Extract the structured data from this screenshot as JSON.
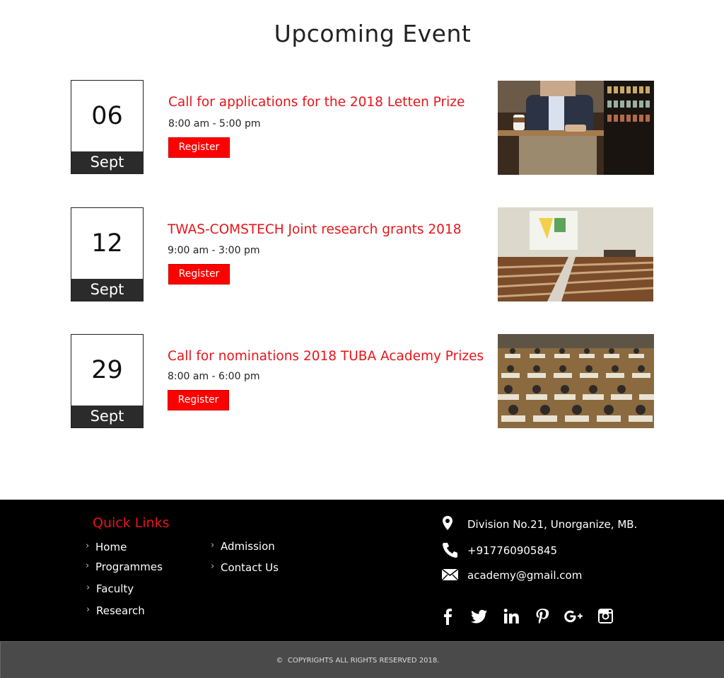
{
  "section": {
    "title": "Upcoming Event"
  },
  "events": [
    {
      "day": "06",
      "month": "Sept",
      "title": "Call for applications for the 2018 Letten Prize",
      "time": "8:00 am - 5:00 pm",
      "register_label": "Register",
      "image": "man-at-cafe-table-photo"
    },
    {
      "day": "12",
      "month": "Sept",
      "title": "TWAS-COMSTECH Joint research grants 2018",
      "time": "9:00 am - 3:00 pm",
      "register_label": "Register",
      "image": "lecture-hall-photo"
    },
    {
      "day": "29",
      "month": "Sept",
      "title": "Call for nominations 2018 TUBA Academy Prizes",
      "time": "8:00 am - 6:00 pm",
      "register_label": "Register",
      "image": "exam-hall-photo"
    }
  ],
  "footer": {
    "quick_links_title": "Quick Links",
    "quick_links": {
      "col1": [
        "Home",
        "Programmes",
        "Faculty",
        "Research"
      ],
      "col2": [
        "Admission",
        "Contact Us"
      ]
    },
    "contact": {
      "address": "Division No.21, Unorganize, MB.",
      "phone": "+917760905845",
      "email": "academy@gmail.com"
    },
    "social": [
      "facebook-icon",
      "twitter-icon",
      "linkedin-icon",
      "pinterest-icon",
      "google-plus-icon",
      "instagram-icon"
    ]
  },
  "copyright": {
    "symbol": "©",
    "text": "COPYRIGHTS ALL RIGHTS RESERVED 2018."
  },
  "colors": {
    "accent": "#e8141a",
    "button": "#ff0000",
    "footer_bg": "#000000",
    "copyright_bg": "#4a4a4a",
    "date_band": "#2b2b2b"
  }
}
